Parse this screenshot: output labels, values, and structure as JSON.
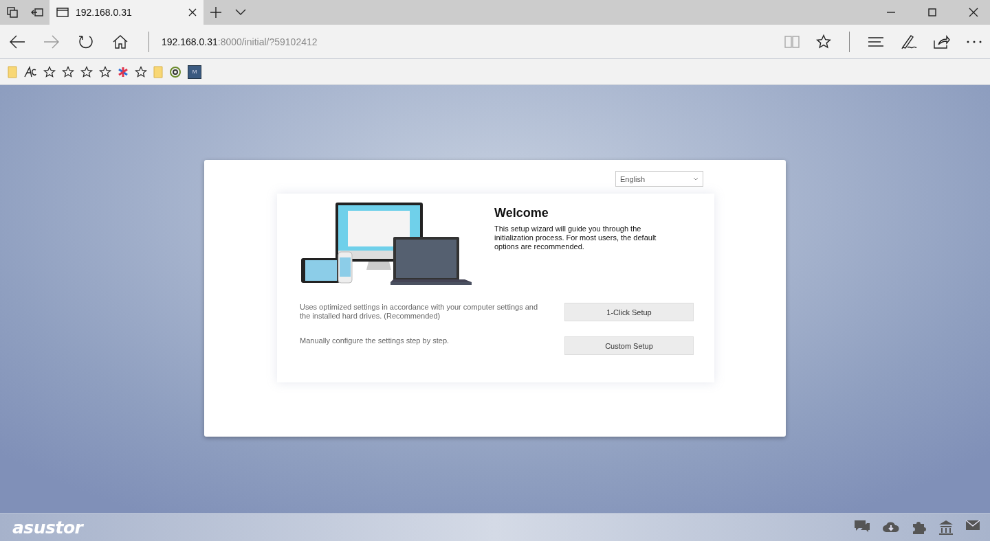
{
  "browser": {
    "tab": {
      "title": "192.168.0.31",
      "selected": true
    },
    "address": {
      "host": "192.168.0.31",
      "rest": ":8000/initial/?59102412"
    },
    "favorites": [
      {
        "kind": "folder"
      },
      {
        "kind": "app"
      },
      {
        "kind": "star"
      },
      {
        "kind": "star"
      },
      {
        "kind": "star"
      },
      {
        "kind": "star"
      },
      {
        "kind": "asterisk"
      },
      {
        "kind": "star"
      },
      {
        "kind": "folder"
      },
      {
        "kind": "swirl"
      },
      {
        "kind": "tile",
        "label": "M"
      }
    ]
  },
  "setup": {
    "language": "English",
    "title": "Welcome",
    "intro": "This setup wizard will guide you through the initialization process. For most users, the default options are recommended.",
    "options": [
      {
        "description": "Uses optimized settings in accordance with your computer settings and the installed hard drives. (Recommended)",
        "button": "1-Click Setup"
      },
      {
        "description": "Manually configure the settings step by step.",
        "button": "Custom Setup"
      }
    ]
  },
  "footer": {
    "logo": "asustor"
  }
}
